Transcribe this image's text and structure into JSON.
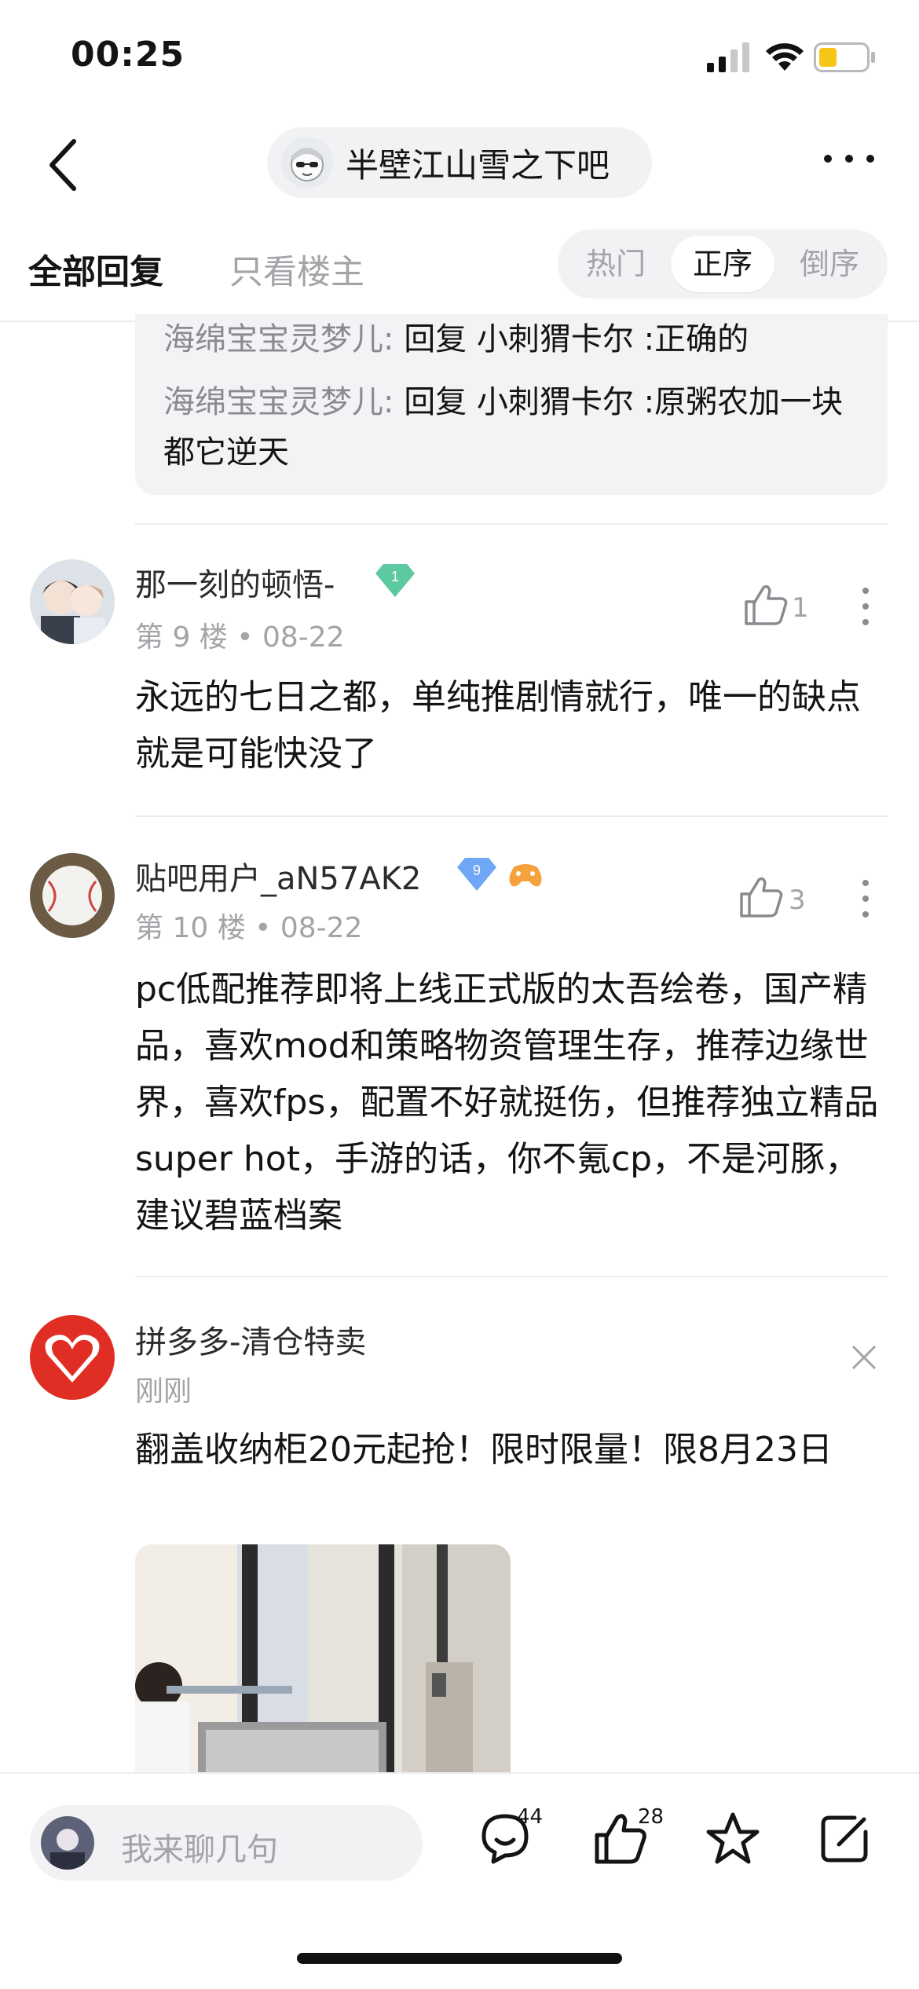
{
  "status_bar": {
    "time": "00:25",
    "icons": [
      "signal-icon",
      "wifi-icon",
      "battery-icon"
    ],
    "battery_color": "#f5c518"
  },
  "nav": {
    "back_icon": "chevron-left-icon",
    "forum_name": "半壁江山雪之下吧",
    "more_icon": "more-dots-icon"
  },
  "tabs": {
    "all_replies": "全部回复",
    "op_only": "只看楼主",
    "sort": {
      "hot": "热门",
      "asc": "正序",
      "desc": "倒序",
      "active": "正序"
    }
  },
  "sub_replies": [
    {
      "user": "海绵宝宝灵梦儿:",
      "text": " 回复 小刺猬卡尔 :正确的"
    },
    {
      "user": "海绵宝宝灵梦儿:",
      "text": " 回复 小刺猬卡尔 :原粥农加一块都它逆天"
    }
  ],
  "posts": [
    {
      "username": "那一刻的顿悟-",
      "level": "1",
      "level_color": "#5cc9a0",
      "floor": "第 9 楼",
      "dot": "•",
      "date": "08-22",
      "likes": "1",
      "content": "永远的七日之都，单纯推剧情就行，唯一的缺点就是可能快没了"
    },
    {
      "username": "贴吧用户_aN57AK2",
      "level": "9",
      "level_color": "#6fa6f5",
      "floor": "第 10 楼",
      "dot": "•",
      "date": "08-22",
      "likes": "3",
      "content": "pc低配推荐即将上线正式版的太吾绘卷，国产精品，喜欢mod和策略物资管理生存，推荐边缘世界，喜欢fps，配置不好就挺伤，但推荐独立精品super hot，手游的话，你不氪cp，不是河豚，建议碧蓝档案"
    }
  ],
  "ad": {
    "advertiser": "拼多多-清仓特卖",
    "time": "刚刚",
    "text": "翻盖收纳柜20元起抢！限时限量！限8月23日",
    "brand_color": "#e02e24"
  },
  "bottom_bar": {
    "placeholder": "我来聊几句",
    "comments_count": "44",
    "likes_count": "28",
    "icons": [
      "comment-icon",
      "like-icon",
      "star-icon",
      "share-icon"
    ]
  }
}
